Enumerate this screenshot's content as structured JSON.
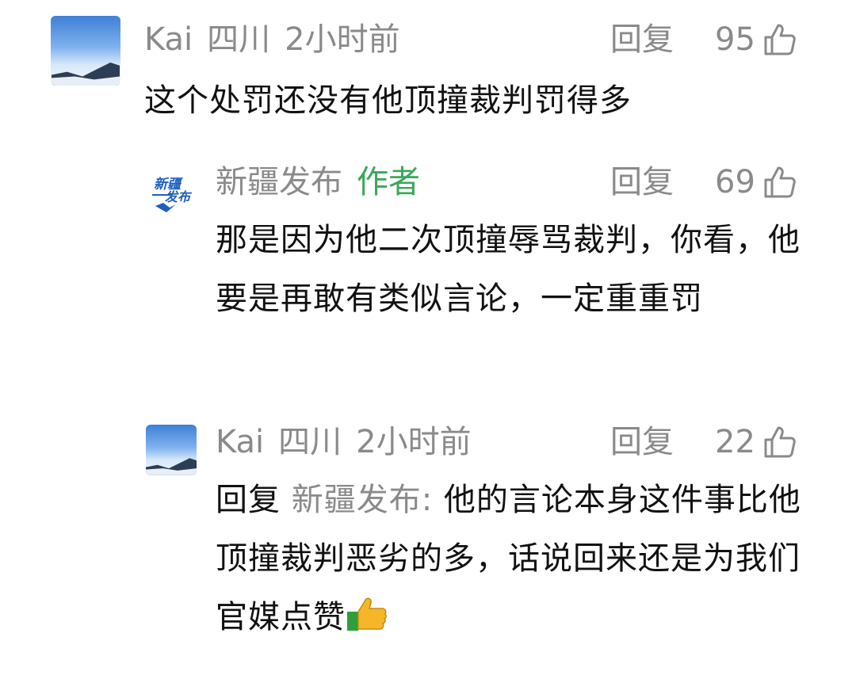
{
  "comments": [
    {
      "user": "Kai",
      "location": "四川",
      "time": "2小时前",
      "reply_label": "回复",
      "likes": "95",
      "text": "这个处罚还没有他顶撞裁判罚得多"
    },
    {
      "user": "新疆发布",
      "author_tag": "作者",
      "reply_label": "回复",
      "likes": "69",
      "text": "那是因为他二次顶撞辱骂裁判，你看，他要是再敢有类似言论，一定重重罚",
      "logo_text_top": "新疆",
      "logo_text_bottom": "发布"
    },
    {
      "user": "Kai",
      "location": "四川",
      "time": "2小时前",
      "reply_label": "回复",
      "likes": "22",
      "reply_prefix": "回复",
      "reply_target": "新疆发布:",
      "text": "他的言论本身这件事比他顶撞裁判恶劣的多，话说回来还是为我们官媒点赞"
    }
  ],
  "icons": {
    "like": "thumbs-up-outline-icon",
    "emoji": "thumbs-up-emoji"
  },
  "colors": {
    "meta_gray": "#8a8a8a",
    "author_green": "#3aa857",
    "text": "#111111",
    "logo_blue": "#1f5fbf"
  }
}
